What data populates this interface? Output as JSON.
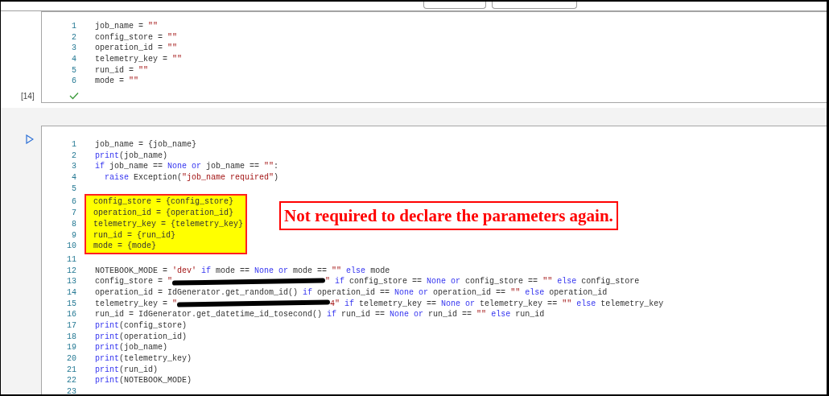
{
  "cells": [
    {
      "execution_count": "[14]",
      "succeeded": true,
      "run_button": false,
      "blocks": [
        {
          "highlighted": false,
          "lines": [
            {
              "number": "1",
              "tokens": [
                {
                  "kind": "plain",
                  "text": "job_name = "
                },
                {
                  "kind": "string",
                  "text": "\"\""
                }
              ]
            },
            {
              "number": "2",
              "tokens": [
                {
                  "kind": "plain",
                  "text": "config_store = "
                },
                {
                  "kind": "string",
                  "text": "\"\""
                }
              ]
            },
            {
              "number": "3",
              "tokens": [
                {
                  "kind": "plain",
                  "text": "operation_id = "
                },
                {
                  "kind": "string",
                  "text": "\"\""
                }
              ]
            },
            {
              "number": "4",
              "tokens": [
                {
                  "kind": "plain",
                  "text": "telemetry_key = "
                },
                {
                  "kind": "string",
                  "text": "\"\""
                }
              ]
            },
            {
              "number": "5",
              "tokens": [
                {
                  "kind": "plain",
                  "text": "run_id = "
                },
                {
                  "kind": "string",
                  "text": "\"\""
                }
              ]
            },
            {
              "number": "6",
              "tokens": [
                {
                  "kind": "plain",
                  "text": "mode = "
                },
                {
                  "kind": "string",
                  "text": "\"\""
                }
              ]
            }
          ]
        }
      ]
    },
    {
      "succeeded": false,
      "run_button": true,
      "blocks": [
        {
          "highlighted": false,
          "lines": [
            {
              "number": "1",
              "tokens": [
                {
                  "kind": "plain",
                  "text": "job_name = {job_name}"
                }
              ]
            },
            {
              "number": "2",
              "tokens": [
                {
                  "kind": "keyword",
                  "text": "print"
                },
                {
                  "kind": "plain",
                  "text": "(job_name)"
                }
              ]
            },
            {
              "number": "3",
              "tokens": [
                {
                  "kind": "keyword",
                  "text": "if"
                },
                {
                  "kind": "plain",
                  "text": " job_name == "
                },
                {
                  "kind": "keyword",
                  "text": "None or"
                },
                {
                  "kind": "plain",
                  "text": " job_name == "
                },
                {
                  "kind": "string",
                  "text": "\"\""
                },
                {
                  "kind": "plain",
                  "text": ":"
                }
              ]
            },
            {
              "number": "4",
              "tokens": [
                {
                  "kind": "keyword",
                  "text": "  raise"
                },
                {
                  "kind": "plain",
                  "text": " Exception("
                },
                {
                  "kind": "string",
                  "text": "\"job_name required\""
                },
                {
                  "kind": "plain",
                  "text": ")"
                }
              ]
            },
            {
              "number": "5"
            }
          ]
        },
        {
          "highlighted": true,
          "lines": [
            {
              "number": "6",
              "tokens": [
                {
                  "kind": "plain",
                  "text": "config_store = {config_store}"
                }
              ]
            },
            {
              "number": "7",
              "tokens": [
                {
                  "kind": "plain",
                  "text": "operation_id = {operation_id}"
                }
              ]
            },
            {
              "number": "8",
              "tokens": [
                {
                  "kind": "plain",
                  "text": "telemetry_key = {telemetry_key}"
                }
              ]
            },
            {
              "number": "9",
              "tokens": [
                {
                  "kind": "plain",
                  "text": "run_id = {run_id}"
                }
              ]
            },
            {
              "number": "10",
              "tokens": [
                {
                  "kind": "plain",
                  "text": "mode = {mode}"
                }
              ]
            }
          ]
        },
        {
          "highlighted": false,
          "lines": [
            {
              "number": "11"
            },
            {
              "number": "12",
              "tokens": [
                {
                  "kind": "plain",
                  "text": "NOTEBOOK_MODE = "
                },
                {
                  "kind": "string",
                  "text": "'dev'"
                },
                {
                  "kind": "keyword",
                  "text": " if"
                },
                {
                  "kind": "plain",
                  "text": " mode == "
                },
                {
                  "kind": "keyword",
                  "text": "None or"
                },
                {
                  "kind": "plain",
                  "text": " mode == "
                },
                {
                  "kind": "string",
                  "text": "\"\""
                },
                {
                  "kind": "keyword",
                  "text": " else"
                },
                {
                  "kind": "plain",
                  "text": " mode"
                }
              ]
            },
            {
              "number": "13",
              "tokens": [
                {
                  "kind": "plain",
                  "text": "config_store = "
                },
                {
                  "kind": "string",
                  "text": "\""
                },
                {
                  "kind": "redacted"
                },
                {
                  "kind": "string",
                  "text": "\""
                },
                {
                  "kind": "keyword",
                  "text": " if"
                },
                {
                  "kind": "plain",
                  "text": " config_store == "
                },
                {
                  "kind": "keyword",
                  "text": "None or"
                },
                {
                  "kind": "plain",
                  "text": " config_store == "
                },
                {
                  "kind": "string",
                  "text": "\"\""
                },
                {
                  "kind": "keyword",
                  "text": " else"
                },
                {
                  "kind": "plain",
                  "text": " config_store"
                }
              ]
            },
            {
              "number": "14",
              "tokens": [
                {
                  "kind": "plain",
                  "text": "operation_id = IdGenerator.get_random_id() "
                },
                {
                  "kind": "keyword",
                  "text": "if"
                },
                {
                  "kind": "plain",
                  "text": " operation_id == "
                },
                {
                  "kind": "keyword",
                  "text": "None or"
                },
                {
                  "kind": "plain",
                  "text": " operation_id == "
                },
                {
                  "kind": "string",
                  "text": "\"\""
                },
                {
                  "kind": "keyword",
                  "text": " else"
                },
                {
                  "kind": "plain",
                  "text": " operation_id"
                }
              ]
            },
            {
              "number": "15",
              "tokens": [
                {
                  "kind": "plain",
                  "text": "telemetry_key = "
                },
                {
                  "kind": "string",
                  "text": "\""
                },
                {
                  "kind": "redacted"
                },
                {
                  "kind": "string",
                  "text": "4\""
                },
                {
                  "kind": "keyword",
                  "text": " if"
                },
                {
                  "kind": "plain",
                  "text": " telemetry_key == "
                },
                {
                  "kind": "keyword",
                  "text": "None or"
                },
                {
                  "kind": "plain",
                  "text": " telemetry_key == "
                },
                {
                  "kind": "string",
                  "text": "\"\""
                },
                {
                  "kind": "keyword",
                  "text": " else"
                },
                {
                  "kind": "plain",
                  "text": " telemetry_key"
                }
              ]
            },
            {
              "number": "16",
              "tokens": [
                {
                  "kind": "plain",
                  "text": "run_id = IdGenerator.get_datetime_id_tosecond() "
                },
                {
                  "kind": "keyword",
                  "text": "if"
                },
                {
                  "kind": "plain",
                  "text": " run_id == "
                },
                {
                  "kind": "keyword",
                  "text": "None or"
                },
                {
                  "kind": "plain",
                  "text": " run_id == "
                },
                {
                  "kind": "string",
                  "text": "\"\""
                },
                {
                  "kind": "keyword",
                  "text": " else"
                },
                {
                  "kind": "plain",
                  "text": " run_id"
                }
              ]
            },
            {
              "number": "17",
              "tokens": [
                {
                  "kind": "keyword",
                  "text": "print"
                },
                {
                  "kind": "plain",
                  "text": "(config_store)"
                }
              ]
            },
            {
              "number": "18",
              "tokens": [
                {
                  "kind": "keyword",
                  "text": "print"
                },
                {
                  "kind": "plain",
                  "text": "(operation_id)"
                }
              ]
            },
            {
              "number": "19",
              "tokens": [
                {
                  "kind": "keyword",
                  "text": "print"
                },
                {
                  "kind": "plain",
                  "text": "(job_name)"
                }
              ]
            },
            {
              "number": "20",
              "tokens": [
                {
                  "kind": "keyword",
                  "text": "print"
                },
                {
                  "kind": "plain",
                  "text": "(telemetry_key)"
                }
              ]
            },
            {
              "number": "21",
              "tokens": [
                {
                  "kind": "keyword",
                  "text": "print"
                },
                {
                  "kind": "plain",
                  "text": "(run_id)"
                }
              ]
            },
            {
              "number": "22",
              "tokens": [
                {
                  "kind": "keyword",
                  "text": "print"
                },
                {
                  "kind": "plain",
                  "text": "(NOTEBOOK_MODE)"
                }
              ]
            },
            {
              "number": "23"
            }
          ]
        }
      ]
    }
  ],
  "callout": "Not required to declare the parameters again."
}
